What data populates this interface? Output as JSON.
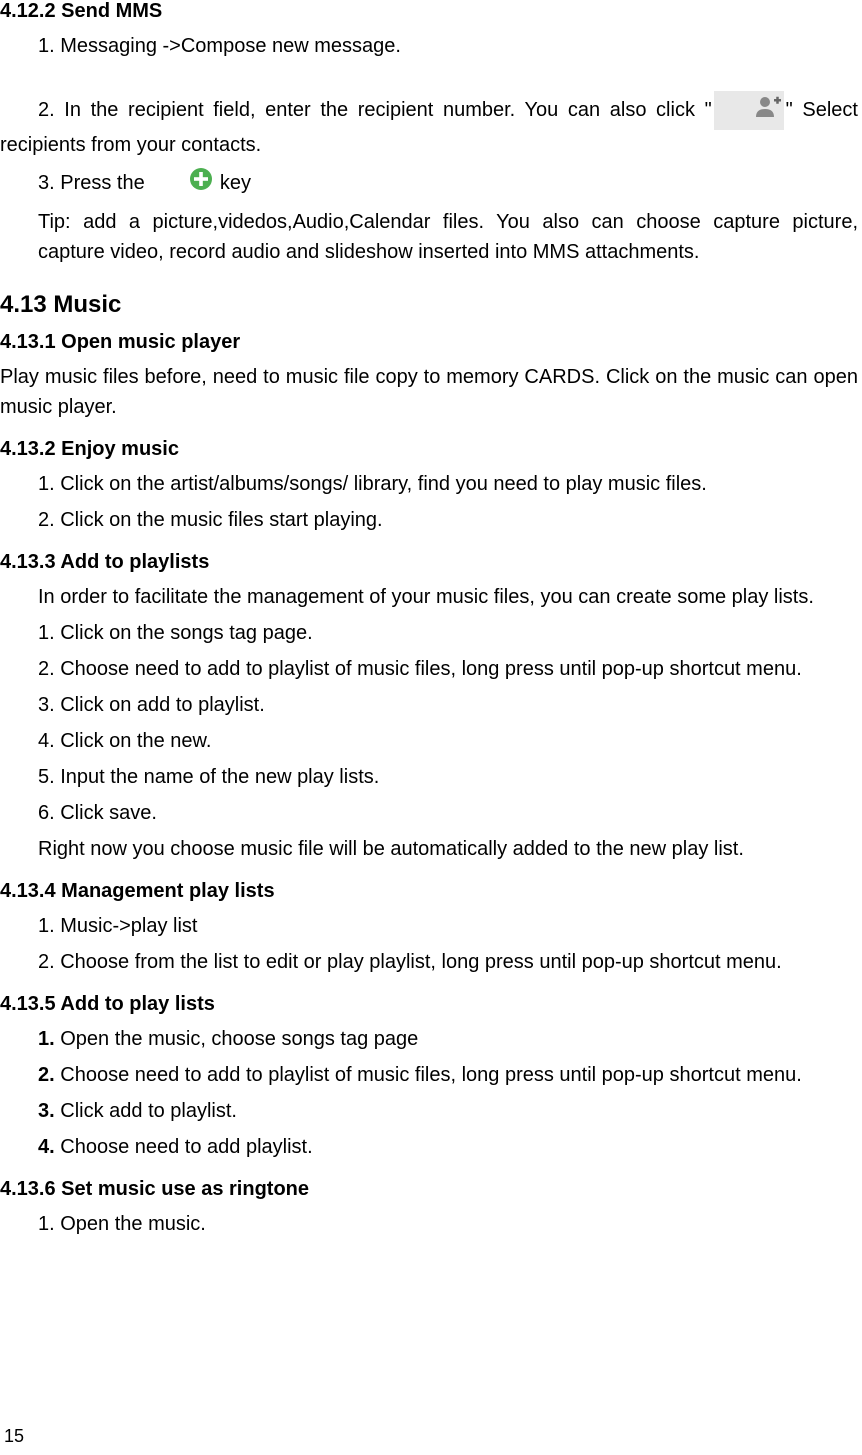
{
  "s_4_12_2": {
    "heading": "4.12.2  Send MMS",
    "p1": "1. Messaging ->Compose new message.",
    "p2a": "2. In the recipient field, enter the recipient number. You can also click \"",
    "p2b": "\" Select recipients from your contacts.",
    "p3a": "3. Press the  ",
    "p3b": " key",
    "tip1": "Tip: add a picture,videdos,Audio,Calendar files. You also can choose capture picture, capture video, record audio and slideshow inserted into MMS attachments."
  },
  "s_4_13": {
    "heading": "4.13  Music"
  },
  "s_4_13_1": {
    "heading": "4.13.1  Open music player",
    "p1": "Play music files before, need to music file copy to memory CARDS. Click on the music can open music player."
  },
  "s_4_13_2": {
    "heading": "4.13.2  Enjoy music",
    "p1": "1. Click on the artist/albums/songs/ library, find you need to play music files.",
    "p2": "2. Click on the music files start playing."
  },
  "s_4_13_3": {
    "heading": "4.13.3  Add to playlists",
    "intro": "In order to facilitate the management of your music files, you can create some play lists.",
    "p1": "1. Click on the songs tag page.",
    "p2": "2. Choose need to add to playlist of music files, long press until pop-up shortcut menu.",
    "p3": "3. Click on add to playlist.",
    "p4": "4. Click on the new.",
    "p5": "5. Input the name of the new play lists.",
    "p6": "6. Click save.",
    "note": "Right now you choose music file will be automatically added to the new play list."
  },
  "s_4_13_4": {
    "heading": "4.13.4  Management play lists",
    "p1": "1. Music->play list",
    "p2": "2. Choose from the list to edit or play playlist, long press until pop-up shortcut menu."
  },
  "s_4_13_5": {
    "heading": "4.13.5  Add to play lists",
    "n1": "1. ",
    "t1": "Open the music, choose songs tag page",
    "n2": "2. ",
    "t2": "Choose need to add to playlist of music files, long press until pop-up shortcut menu.",
    "n3": "3. ",
    "t3": "Click add to playlist.",
    "n4": "4. ",
    "t4": "Choose need to add playlist."
  },
  "s_4_13_6": {
    "heading": "4.13.6  Set music use as ringtone",
    "p1": "1. Open the music."
  },
  "page_number": "15",
  "icons": {
    "add_contact": "add-contact-icon",
    "plus": "plus-circle-icon"
  }
}
